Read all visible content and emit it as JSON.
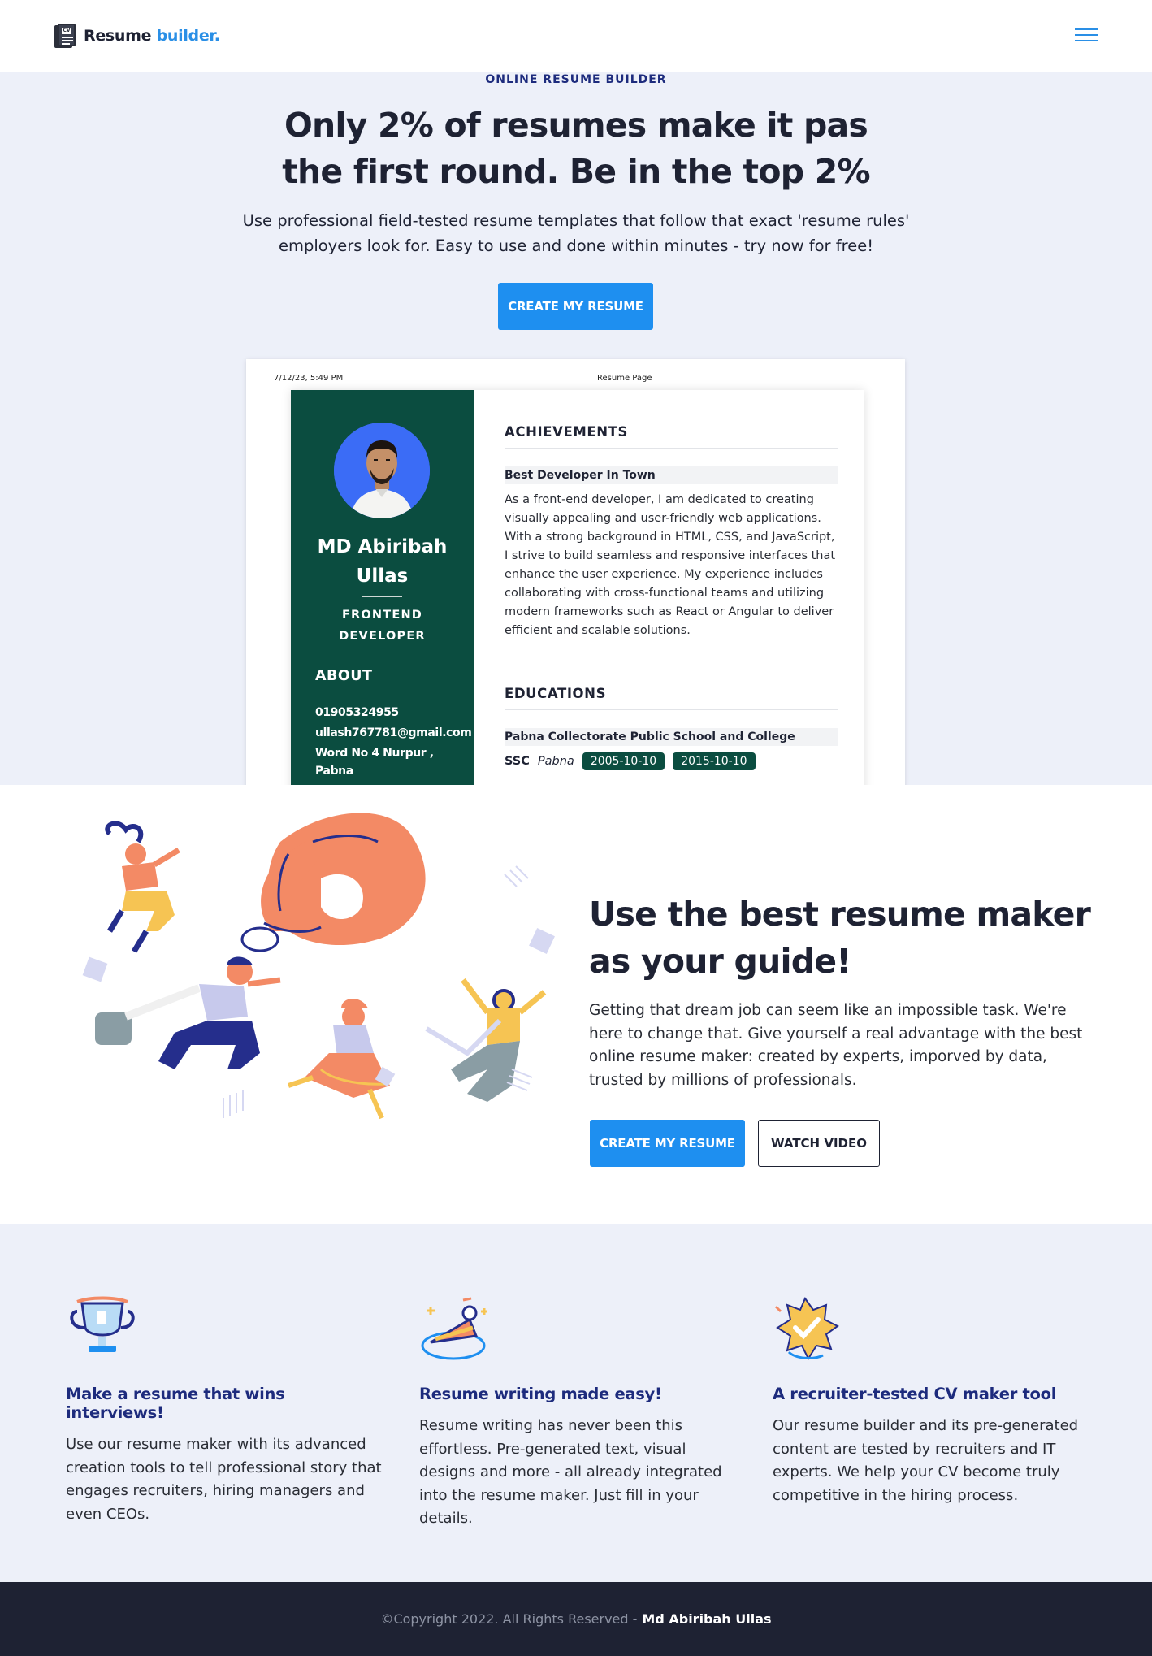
{
  "nav": {
    "brand_main": "Resume",
    "brand_accent": "builder.",
    "logo_text": "CV",
    "menu_icon": "hamburger-menu-icon"
  },
  "hero": {
    "eyebrow": "ONLINE RESUME BUILDER",
    "title": "Only 2% of resumes make it pas the first round. Be in the top 2%",
    "subtitle": "Use professional field-tested resume templates that follow that exact 'resume rules' employers look for. Easy to use and done within minutes - try now for free!",
    "cta": "CREATE MY RESUME"
  },
  "preview": {
    "timestamp": "7/12/23, 5:49 PM",
    "page_title": "Resume Page",
    "name": "MD Abiribah Ullas",
    "role": "FRONTEND DEVELOPER",
    "about_heading": "ABOUT",
    "phone": "01905324955",
    "email": "ullash767781@gmail.com",
    "address": "Word No 4 Nurpur , Pabna",
    "achievements_heading": "ACHIEVEMENTS",
    "achievement_title": "Best Developer In Town",
    "achievement_text": "As a front-end developer, I am dedicated to creating visually appealing and user-friendly web applications. With a strong background in HTML, CSS, and JavaScript, I strive to build seamless and responsive interfaces that enhance the user experience. My experience includes collaborating with cross-functional teams and utilizing modern frameworks such as React or Angular to deliver efficient and scalable solutions.",
    "educations_heading": "EDUCATIONS",
    "school": "Pabna Collectorate Public School and College",
    "degree": "SSC",
    "location": "Pabna",
    "start_date": "2005-10-10",
    "end_date": "2015-10-10",
    "colors": {
      "sidebar": "#0b4d40",
      "avatar_bg": "#3b6cf6"
    }
  },
  "guide": {
    "title": "Use the best resume maker as your guide!",
    "text": "Getting that dream job can seem like an impossible task. We're here to change that. Give yourself a real advantage with the best online resume maker: created by experts, imporved by data, trusted by millions of professionals.",
    "cta_primary": "CREATE MY RESUME",
    "cta_secondary": "WATCH VIDEO"
  },
  "features": [
    {
      "icon": "trophy-icon",
      "title": "Make a resume that wins interviews!",
      "text": "Use our resume maker with its advanced creation tools to tell professional story that engages recruiters, hiring managers and even CEOs."
    },
    {
      "icon": "cake-slice-icon",
      "title": "Resume writing made easy!",
      "text": "Resume writing has never been this effortless. Pre-generated text, visual designs and more - all already integrated into the resume maker. Just fill in your details."
    },
    {
      "icon": "verified-badge-icon",
      "title": "A recruiter-tested CV maker tool",
      "text": "Our resume builder and its pre-generated content are tested by recruiters and IT experts. We help your CV become truly competitive in the hiring process."
    }
  ],
  "footer": {
    "copyright": "©Copyright 2022. All Rights Reserved -",
    "author": "Md Abiribah Ullas"
  },
  "theme": {
    "accent": "#1e8ff0",
    "navy": "#1d2b7d",
    "hero_bg": "#edf0f9",
    "footer_bg": "#1e2233"
  }
}
